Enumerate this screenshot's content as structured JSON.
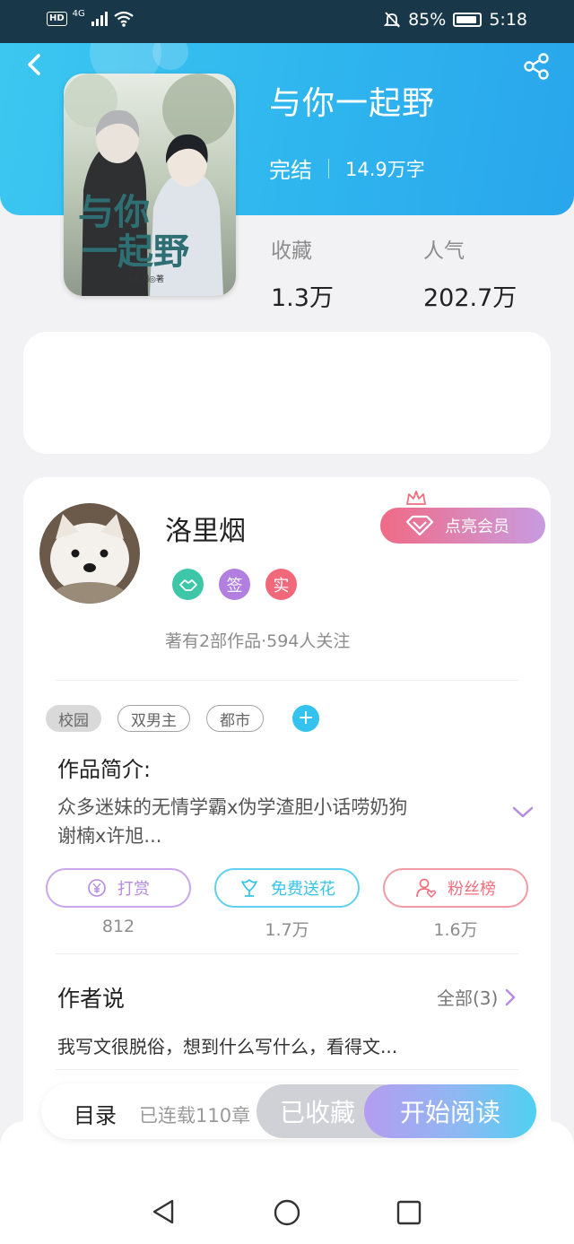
{
  "status_bar": {
    "hd": "HD",
    "network": "4G",
    "battery": "85%",
    "time": "5:18"
  },
  "book": {
    "title": "与你一起野",
    "status": "完结",
    "word_count": "14.9万字",
    "cover_title": "与你一起野",
    "cover_author": "洛里烟◎著",
    "stats": [
      {
        "label": "收藏",
        "value": "1.3万"
      },
      {
        "label": "人气",
        "value": "202.7万"
      }
    ]
  },
  "author": {
    "name": "洛里烟",
    "badges": [
      {
        "icon": "handshake-icon",
        "text": "",
        "color": "#3ec6a8"
      },
      {
        "icon": "signed-badge",
        "text": "签",
        "color": "#b27fe0"
      },
      {
        "icon": "verified-badge",
        "text": "实",
        "color": "#f2687b"
      }
    ],
    "works_line": "著有2部作品·594人关注",
    "vip_button": "点亮会员"
  },
  "tags": [
    {
      "label": "校园",
      "selected": true
    },
    {
      "label": "双男主",
      "selected": false
    },
    {
      "label": "都市",
      "selected": false
    }
  ],
  "tag_add": "+",
  "intro": {
    "title": "作品简介:",
    "line1": "众多迷妹的无情学霸x伪学渣胆小话唠奶狗",
    "line2": "谢楠x许旭..."
  },
  "actions": [
    {
      "label": "打赏",
      "count": "812",
      "color": "#b58ae0",
      "icon": "yuan-icon"
    },
    {
      "label": "免费送花",
      "count": "1.7万",
      "color": "#34c4ea",
      "icon": "flower-icon"
    },
    {
      "label": "粉丝榜",
      "count": "1.6万",
      "color": "#ef6f7c",
      "icon": "user-heart-icon"
    }
  ],
  "author_says": {
    "title": "作者说",
    "all_label": "全部(3)",
    "text": "我写文很脱俗，想到什么写什么，看得文..."
  },
  "bottom_bar": {
    "toc": "目录",
    "serial": "已连载110章",
    "collected": "已收藏",
    "read": "开始阅读"
  }
}
